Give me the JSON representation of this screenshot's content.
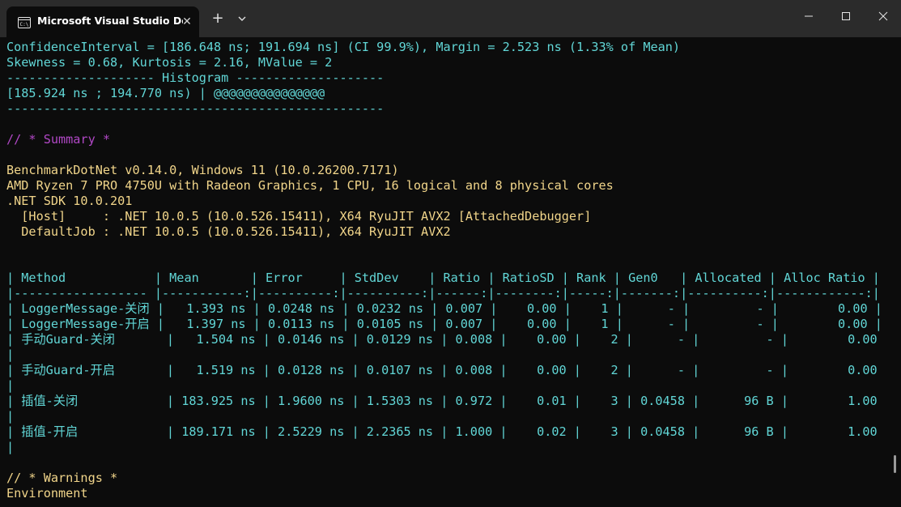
{
  "window": {
    "tab_title": "Microsoft Visual Studio Debug",
    "tab_close": "✕",
    "new_tab": "+",
    "icons": [
      "terminal-icon",
      "close-icon",
      "plus-icon",
      "chevron-down-icon",
      "minimize-icon",
      "maximize-icon",
      "close-window-icon"
    ]
  },
  "colors": {
    "cyan": "#61d6d6",
    "purple": "#b148c6",
    "yellow": "#f1d58a",
    "white": "#f2f2f2"
  },
  "terminal": {
    "lines": [
      "ConfidenceInterval = [186.648 ns; 191.694 ns] (CI 99.9%), Margin = 2.523 ns (1.33% of Mean)",
      "Skewness = 0.68, Kurtosis = 2.16, MValue = 2",
      "-------------------- Histogram --------------------",
      "[185.924 ns ; 194.770 ns) | @@@@@@@@@@@@@@@",
      "---------------------------------------------------",
      "",
      "// * Summary *",
      "",
      "BenchmarkDotNet v0.14.0, Windows 11 (10.0.26200.7171)",
      "AMD Ryzen 7 PRO 4750U with Radeon Graphics, 1 CPU, 16 logical and 8 physical cores",
      ".NET SDK 10.0.201",
      "  [Host]     : .NET 10.0.5 (10.0.526.15411), X64 RyuJIT AVX2 [AttachedDebugger]",
      "  DefaultJob : .NET 10.0.5 (10.0.526.15411), X64 RyuJIT AVX2",
      "",
      "",
      "| Method            | Mean       | Error     | StdDev    | Ratio | RatioSD | Rank | Gen0   | Allocated | Alloc Ratio |",
      "|------------------ |-----------:|----------:|----------:|------:|--------:|-----:|-------:|----------:|------------:|",
      "| LoggerMessage-关闭 |   1.393 ns | 0.0248 ns | 0.0232 ns | 0.007 |    0.00 |    1 |      - |         - |        0.00 |",
      "| LoggerMessage-开启 |   1.397 ns | 0.0113 ns | 0.0105 ns | 0.007 |    0.00 |    1 |      - |         - |        0.00 |",
      "| 手动Guard-关闭       |   1.504 ns | 0.0146 ns | 0.0129 ns | 0.008 |    0.00 |    2 |      - |         - |        0.00",
      "|",
      "| 手动Guard-开启       |   1.519 ns | 0.0128 ns | 0.0107 ns | 0.008 |    0.00 |    2 |      - |         - |        0.00",
      "|",
      "| 插值-关闭            | 183.925 ns | 1.9600 ns | 1.5303 ns | 0.972 |    0.01 |    3 | 0.0458 |      96 B |        1.00",
      "|",
      "| 插值-开启            | 189.171 ns | 2.5229 ns | 2.2365 ns | 1.000 |    0.02 |    3 | 0.0458 |      96 B |        1.00",
      "|",
      "",
      "// * Warnings *",
      "Environment"
    ]
  }
}
